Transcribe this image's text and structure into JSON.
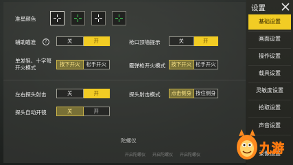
{
  "crosshair_color": {
    "label": "准星颜色",
    "swatches": [
      {
        "color": "#ffffff"
      },
      {
        "color": "#3fe05a"
      },
      {
        "color": "#ffffff"
      },
      {
        "color": "#3fe05a"
      }
    ]
  },
  "aim_assist": {
    "label": "辅助瞄准",
    "help": "?",
    "off": "关",
    "on": "开",
    "value": "on"
  },
  "muzzle_hint": {
    "label": "枪口顶墙提示",
    "off": "关",
    "on": "开",
    "value": "on"
  },
  "sniper_fire": {
    "label_line1": "单发狙、十字弩",
    "label_line2": "开火模式",
    "opt1": "按下开火",
    "opt2": "松手开火",
    "value": "opt1"
  },
  "shotgun_fire": {
    "label": "霰弹枪开火模式",
    "opt1": "按下开火",
    "opt2": "松手开火",
    "value": "opt1"
  },
  "peek_fire": {
    "label": "左右探头射击",
    "off": "关",
    "on": "开",
    "value": "on"
  },
  "peek_mode": {
    "label": "探头射击模式",
    "opt1": "点击侧身",
    "opt2": "按住侧身",
    "value": "opt1"
  },
  "peek_scope": {
    "label": "探头自动开镜",
    "off": "关",
    "on": "开",
    "value": "off"
  },
  "faded": {
    "gyro": "陀螺仪",
    "a": "开启陀螺仪",
    "b": "开启陀螺仪",
    "c": "开启陀螺仪"
  },
  "sidebar": {
    "title": "设置",
    "close_icon": "close-icon",
    "items": [
      {
        "label": "基础设置",
        "active": true
      },
      {
        "label": "画面设置"
      },
      {
        "label": "操作设置"
      },
      {
        "label": "载具设置"
      },
      {
        "label": "灵敏度设置"
      },
      {
        "label": "拾取设置"
      },
      {
        "label": "声音设置"
      },
      {
        "label": "录像设置"
      }
    ]
  },
  "watermark": {
    "text": "九游"
  },
  "colors": {
    "accent": "#f2cc24",
    "green": "#3fe05a"
  }
}
